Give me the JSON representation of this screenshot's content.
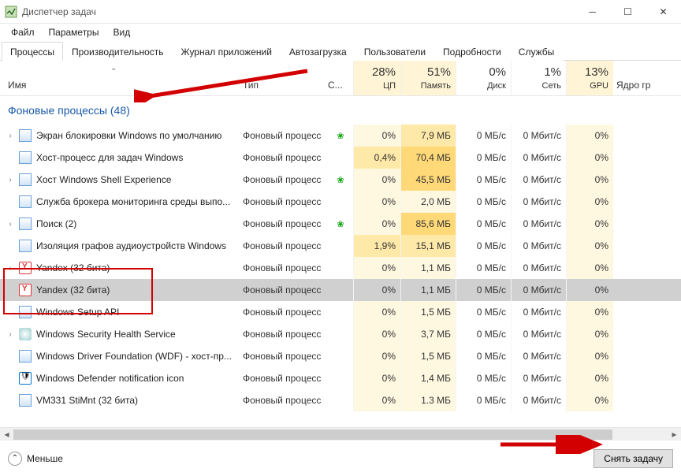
{
  "window": {
    "title": "Диспетчер задач"
  },
  "menu": {
    "file": "Файл",
    "options": "Параметры",
    "view": "Вид"
  },
  "tabs": {
    "processes": "Процессы",
    "performance": "Производительность",
    "apphistory": "Журнал приложений",
    "startup": "Автозагрузка",
    "users": "Пользователи",
    "details": "Подробности",
    "services": "Службы"
  },
  "columns": {
    "name": "Имя",
    "type": "Тип",
    "status": "С...",
    "cpu_pct": "28%",
    "cpu_lbl": "ЦП",
    "mem_pct": "51%",
    "mem_lbl": "Память",
    "disk_pct": "0%",
    "disk_lbl": "Диск",
    "net_pct": "1%",
    "net_lbl": "Сеть",
    "gpu_pct": "13%",
    "gpu_lbl": "GPU",
    "extra": "Ядро гр"
  },
  "group": {
    "label": "Фоновые процессы (48)"
  },
  "rows": [
    {
      "expand": true,
      "icon": "generic",
      "name": "Экран блокировки Windows по умолчанию",
      "type": "Фоновый процесс",
      "leaf": true,
      "cpu": "0%",
      "mem": "7,9 МБ",
      "disk": "0 МБ/с",
      "net": "0 Мбит/с",
      "gpu": "0%",
      "cpu_hl": 0,
      "mem_hl": 1
    },
    {
      "expand": false,
      "icon": "generic",
      "name": "Хост-процесс для задач Windows",
      "type": "Фоновый процесс",
      "leaf": false,
      "cpu": "0,4%",
      "mem": "70,4 МБ",
      "disk": "0 МБ/с",
      "net": "0 Мбит/с",
      "gpu": "0%",
      "cpu_hl": 1,
      "mem_hl": 2
    },
    {
      "expand": true,
      "icon": "generic",
      "name": "Хост Windows Shell Experience",
      "type": "Фоновый процесс",
      "leaf": true,
      "cpu": "0%",
      "mem": "45,5 МБ",
      "disk": "0 МБ/с",
      "net": "0 Мбит/с",
      "gpu": "0%",
      "cpu_hl": 0,
      "mem_hl": 2
    },
    {
      "expand": false,
      "icon": "generic",
      "name": "Служба брокера мониторинга среды выпо...",
      "type": "Фоновый процесс",
      "leaf": false,
      "cpu": "0%",
      "mem": "2,0 МБ",
      "disk": "0 МБ/с",
      "net": "0 Мбит/с",
      "gpu": "0%",
      "cpu_hl": 0,
      "mem_hl": 0
    },
    {
      "expand": true,
      "icon": "generic",
      "name": "Поиск (2)",
      "type": "Фоновый процесс",
      "leaf": true,
      "cpu": "0%",
      "mem": "85,6 МБ",
      "disk": "0 МБ/с",
      "net": "0 Мбит/с",
      "gpu": "0%",
      "cpu_hl": 0,
      "mem_hl": 2
    },
    {
      "expand": false,
      "icon": "generic",
      "name": "Изоляция графов аудиоустройств Windows",
      "type": "Фоновый процесс",
      "leaf": false,
      "cpu": "1,9%",
      "mem": "15,1 МБ",
      "disk": "0 МБ/с",
      "net": "0 Мбит/с",
      "gpu": "0%",
      "cpu_hl": 1,
      "mem_hl": 1
    },
    {
      "expand": true,
      "icon": "yandex",
      "name": "Yandex (32 бита)",
      "type": "Фоновый процесс",
      "leaf": false,
      "cpu": "0%",
      "mem": "1,1 МБ",
      "disk": "0 МБ/с",
      "net": "0 Мбит/с",
      "gpu": "0%",
      "cpu_hl": 0,
      "mem_hl": 0
    },
    {
      "expand": false,
      "icon": "yandex",
      "name": "Yandex (32 бита)",
      "type": "Фоновый процесс",
      "leaf": false,
      "cpu": "0%",
      "mem": "1,1 МБ",
      "disk": "0 МБ/с",
      "net": "0 Мбит/с",
      "gpu": "0%",
      "cpu_hl": 0,
      "mem_hl": 0,
      "selected": true
    },
    {
      "expand": false,
      "icon": "generic",
      "name": "Windows Setup API",
      "type": "Фоновый процесс",
      "leaf": false,
      "cpu": "0%",
      "mem": "1,5 МБ",
      "disk": "0 МБ/с",
      "net": "0 Мбит/с",
      "gpu": "0%",
      "cpu_hl": 0,
      "mem_hl": 0
    },
    {
      "expand": true,
      "icon": "shield",
      "name": "Windows Security Health Service",
      "type": "Фоновый процесс",
      "leaf": false,
      "cpu": "0%",
      "mem": "3,7 МБ",
      "disk": "0 МБ/с",
      "net": "0 Мбит/с",
      "gpu": "0%",
      "cpu_hl": 0,
      "mem_hl": 0
    },
    {
      "expand": false,
      "icon": "generic",
      "name": "Windows Driver Foundation (WDF) - хост-пр...",
      "type": "Фоновый процесс",
      "leaf": false,
      "cpu": "0%",
      "mem": "1,5 МБ",
      "disk": "0 МБ/с",
      "net": "0 Мбит/с",
      "gpu": "0%",
      "cpu_hl": 0,
      "mem_hl": 0
    },
    {
      "expand": false,
      "icon": "defender",
      "name": "Windows Defender notification icon",
      "type": "Фоновый процесс",
      "leaf": false,
      "cpu": "0%",
      "mem": "1,4 МБ",
      "disk": "0 МБ/с",
      "net": "0 Мбит/с",
      "gpu": "0%",
      "cpu_hl": 0,
      "mem_hl": 0
    },
    {
      "expand": false,
      "icon": "generic",
      "name": "VM331 StiMnt (32 бита)",
      "type": "Фоновый процесс",
      "leaf": false,
      "cpu": "0%",
      "mem": "1.3 МБ",
      "disk": "0 МБ/с",
      "net": "0 Мбит/с",
      "gpu": "0%",
      "cpu_hl": 0,
      "mem_hl": 0
    }
  ],
  "footer": {
    "fewer": "Меньше",
    "endtask": "Снять задачу"
  }
}
